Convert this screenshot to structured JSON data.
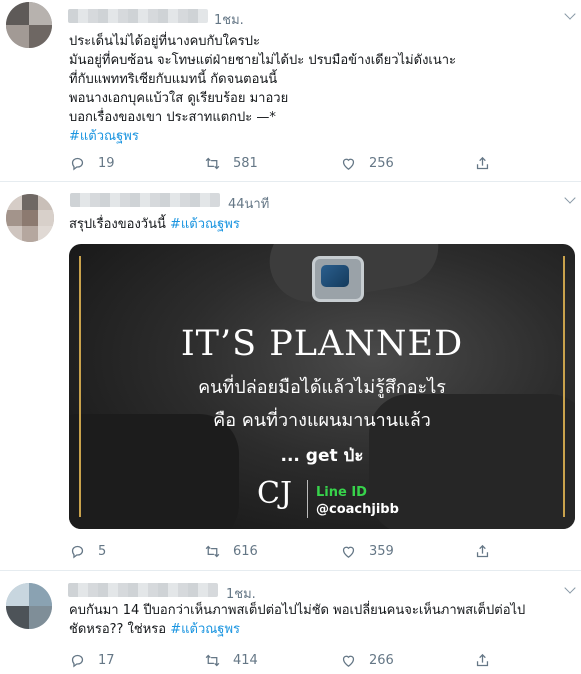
{
  "tweets": [
    {
      "time": "1ชม.",
      "lines": [
        "ประเด็นไม่ได้อยู่ที่นางคบกับใครปะ",
        "มันอยู่ที่คบซ้อน จะโทษแต่ฝ่ายชายไม่ได้ปะ ปรบมือข้างเดียวไม่ดังเนาะ",
        "ที่กับแพททริเซียกับแมทนี้ กัดจนตอนนี้",
        "พอนางเอกบุคแบ้วใส ดูเรียบร้อย มาอวย",
        "บอกเรื่องของเขา ประสาทแตกปะ —*"
      ],
      "hashtag": "#แต้วณฐพร",
      "replies": "19",
      "retweets": "581",
      "likes": "256"
    },
    {
      "time": "44นาที",
      "text": "สรุปเรื่องของวันนี้",
      "hashtag": "#แต้วณฐพร",
      "media": {
        "title": "IT’S PLANNED",
        "line1": "คนที่ปล่อยมือได้แล้วไม่รู้สึกอะไร",
        "line2": "คือ คนที่วางแผนมานานแล้ว",
        "tagline": "... get ป่ะ",
        "logo": "CJ",
        "line_id_label": "Line ID",
        "handle": "@coachjibb"
      },
      "replies": "5",
      "retweets": "616",
      "likes": "359"
    },
    {
      "time": "1ชม.",
      "lines": [
        "คบกันมา 14 ปีบอกว่าเห็นภาพสเต็ปต่อไปไม่ชัด พอเปลี่ยนคนจะเห็นภาพสเต็ปต่อไป"
      ],
      "last_line": "ชัดหรอ?? ใช่หรอ",
      "hashtag": "#แต้วณฐพร",
      "replies": "17",
      "retweets": "414",
      "likes": "266"
    }
  ],
  "icons": {
    "reply": "reply-icon",
    "retweet": "retweet-icon",
    "like": "like-icon",
    "share": "share-icon",
    "caret": "chevron-down-icon"
  },
  "colors": {
    "hashtag": "#1b95e0",
    "meta": "#657786",
    "divider": "#e6ecf0",
    "line_id": "#37d34b",
    "frame": "#c9a24c"
  }
}
